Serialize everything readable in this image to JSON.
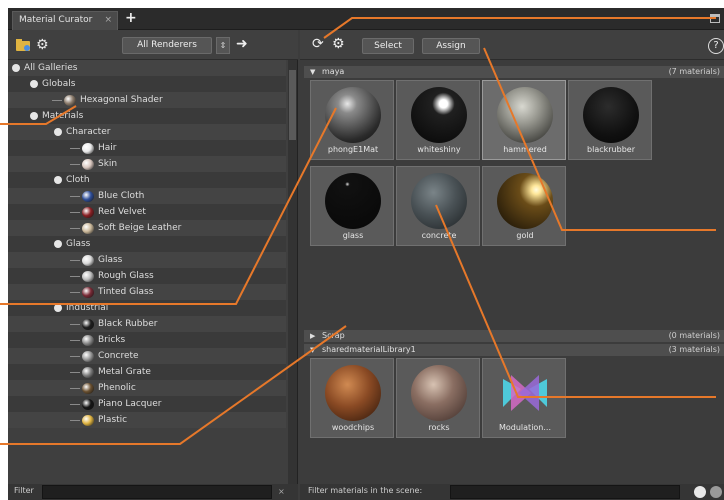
{
  "window": {
    "tab_label": "Material Curator",
    "tab_close": "×",
    "tab_add": "+"
  },
  "left_toolbar": {
    "dropdown_label": "All Renderers",
    "spinner_label": "⇕",
    "arrow_label": "➜"
  },
  "tree": [
    {
      "label": "All Galleries",
      "depth": 0,
      "kind": "expander"
    },
    {
      "label": "Globals",
      "depth": 1,
      "kind": "expander"
    },
    {
      "label": "Hexagonal Shader",
      "depth": 2,
      "kind": "item",
      "color": "#8a7a6a"
    },
    {
      "label": "Materials",
      "depth": 1,
      "kind": "expander"
    },
    {
      "label": "Character",
      "depth": 2,
      "kind": "expander"
    },
    {
      "label": "Hair",
      "depth": 3,
      "kind": "item",
      "color": "#eaeaea"
    },
    {
      "label": "Skin",
      "depth": 3,
      "kind": "item",
      "color": "#d9c7bf"
    },
    {
      "label": "Cloth",
      "depth": 2,
      "kind": "expander"
    },
    {
      "label": "Blue Cloth",
      "depth": 3,
      "kind": "item",
      "color": "#2f4f9a"
    },
    {
      "label": "Red Velvet",
      "depth": 3,
      "kind": "item",
      "color": "#8a1f24"
    },
    {
      "label": "Soft Beige Leather",
      "depth": 3,
      "kind": "item",
      "color": "#cbb89a"
    },
    {
      "label": "Glass",
      "depth": 2,
      "kind": "expander"
    },
    {
      "label": "Glass",
      "depth": 3,
      "kind": "item",
      "color": "#d9d9d9"
    },
    {
      "label": "Rough Glass",
      "depth": 3,
      "kind": "item",
      "color": "#bdbdbd"
    },
    {
      "label": "Tinted Glass",
      "depth": 3,
      "kind": "item",
      "color": "#7a2a36"
    },
    {
      "label": "Industrial",
      "depth": 2,
      "kind": "expander"
    },
    {
      "label": "Black Rubber",
      "depth": 3,
      "kind": "item",
      "color": "#1e1e1e"
    },
    {
      "label": "Bricks",
      "depth": 3,
      "kind": "item",
      "color": "#8a8a8a"
    },
    {
      "label": "Concrete",
      "depth": 3,
      "kind": "item",
      "color": "#9a9a9a"
    },
    {
      "label": "Metal Grate",
      "depth": 3,
      "kind": "item",
      "color": "#7e7e7e"
    },
    {
      "label": "Phenolic",
      "depth": 3,
      "kind": "item",
      "color": "#6a5030"
    },
    {
      "label": "Piano Lacquer",
      "depth": 3,
      "kind": "item",
      "color": "#141414"
    },
    {
      "label": "Plastic",
      "depth": 3,
      "kind": "item",
      "color": "#e0b441"
    }
  ],
  "filter": {
    "label": "Filter",
    "button": "×"
  },
  "right_toolbar": {
    "select_label": "Select",
    "assign_label": "Assign",
    "help_label": "?"
  },
  "groups": [
    {
      "name": "maya",
      "count": "(7 materials)",
      "expanded": true,
      "tiles": [
        {
          "label": "phongE1Mat",
          "style": "grey"
        },
        {
          "label": "whiteshiny",
          "style": "black-shiny"
        },
        {
          "label": "hammered",
          "style": "hammered"
        },
        {
          "label": "blackrubber",
          "style": "black"
        },
        {
          "label": "glass",
          "style": "black-dot"
        },
        {
          "label": "concrete",
          "style": "concrete"
        },
        {
          "label": "gold",
          "style": "gold"
        }
      ]
    },
    {
      "name": "Scrap",
      "count": "(0 materials)",
      "expanded": false,
      "tiles": []
    },
    {
      "name": "sharedmaterialLibrary1",
      "count": "(3 materials)",
      "expanded": true,
      "tiles": [
        {
          "label": "woodchips",
          "style": "wood"
        },
        {
          "label": "rocks",
          "style": "rock"
        },
        {
          "label": "Modulation...",
          "style": "logo"
        }
      ]
    }
  ],
  "bottom": {
    "label": "Filter materials in the scene:"
  }
}
